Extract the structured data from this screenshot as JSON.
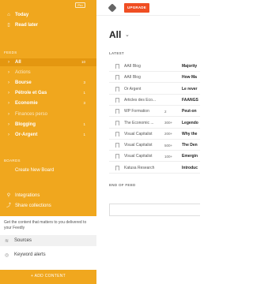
{
  "sidebar": {
    "pro_badge": "Pro",
    "top_items": [
      {
        "icon": "home-icon",
        "glyph": "⌂",
        "label": "Today"
      },
      {
        "icon": "bookmark-icon",
        "glyph": "▯",
        "label": "Read later"
      }
    ],
    "feeds_heading": "FEEDS",
    "feeds": [
      {
        "label": "All",
        "count": "10"
      },
      {
        "label": "Actions",
        "count": ""
      },
      {
        "label": "Bourse",
        "count": "3"
      },
      {
        "label": "Pétrole et Gas",
        "count": "1"
      },
      {
        "label": "Economie",
        "count": "3"
      },
      {
        "label": "Finances perso",
        "count": ""
      },
      {
        "label": "Blogging",
        "count": "1"
      },
      {
        "label": "Or-Argent",
        "count": "1"
      }
    ],
    "boards_heading": "BOARDS",
    "create_board": "Create New Board",
    "integrations": "Integrations",
    "share_collections": "Share collections",
    "hint": {
      "text": "Get the content that matters to you delivered to your Feedly",
      "sources": "Sources",
      "keywords": "Keyword alerts"
    },
    "add_content": "+ ADD CONTENT"
  },
  "main": {
    "upgrade_label": "UPGRADE",
    "title": "All",
    "latest_heading": "LATEST",
    "items": [
      {
        "source": "AAII Blog",
        "engagement": "",
        "title": "Majority"
      },
      {
        "source": "AAII Blog",
        "engagement": "",
        "title": "How Ma"
      },
      {
        "source": "Or Argent",
        "engagement": "",
        "title": "Le rever"
      },
      {
        "source": "Articles des Eco...",
        "engagement": "",
        "title": "FAANGS"
      },
      {
        "source": "WP Formation",
        "engagement": "2",
        "title": "Peut-on"
      },
      {
        "source": "The Economic ...",
        "engagement": "300+",
        "title": "Legendo"
      },
      {
        "source": "Visual Capitalist",
        "engagement": "200+",
        "title": "Why the"
      },
      {
        "source": "Visual Capitalist",
        "engagement": "500+",
        "title": "The Den"
      },
      {
        "source": "Visual Capitalist",
        "engagement": "100+",
        "title": "Emergin"
      },
      {
        "source": "Katusa Research",
        "engagement": "",
        "title": "Introduc"
      }
    ],
    "end_heading": "END OF FEED"
  }
}
